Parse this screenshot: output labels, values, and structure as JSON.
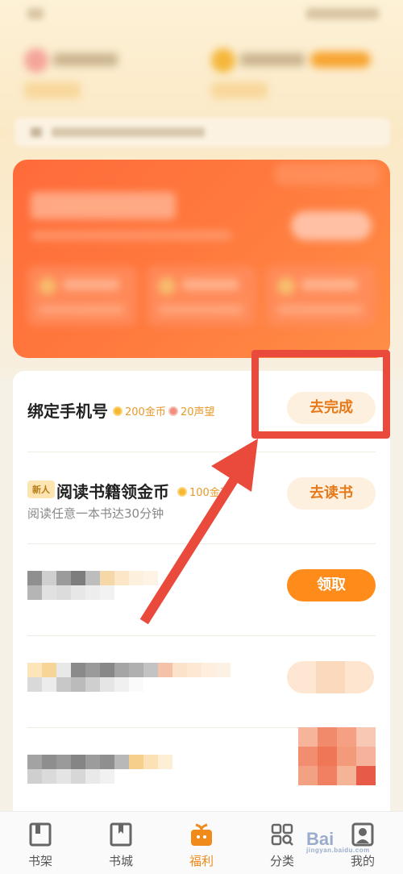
{
  "tasks": [
    {
      "title": "绑定手机号",
      "rewards": [
        {
          "type": "coin",
          "text": "200金币"
        },
        {
          "type": "reputation",
          "text": "20声望"
        }
      ],
      "button": "去完成",
      "button_style": "light"
    },
    {
      "badge": "新人",
      "title": "阅读书籍领金币",
      "rewards": [
        {
          "type": "coin",
          "text": "100金币"
        }
      ],
      "description": "阅读任意一本书达30分钟",
      "button": "去读书",
      "button_style": "light"
    },
    {
      "button": "领取",
      "button_style": "solid"
    }
  ],
  "bottom_nav": {
    "items": [
      {
        "label": "书架",
        "icon": "bookshelf-icon",
        "active": false
      },
      {
        "label": "书城",
        "icon": "bookstore-icon",
        "active": false
      },
      {
        "label": "福利",
        "icon": "gift-icon",
        "active": true
      },
      {
        "label": "分类",
        "icon": "category-icon",
        "active": false
      },
      {
        "label": "我的",
        "icon": "profile-icon",
        "active": false
      }
    ]
  },
  "watermark": {
    "brand": "Bai",
    "sub": "jingyan.baidu.com"
  },
  "colors": {
    "accent_orange": "#ff8c1a",
    "annotation_red": "#e94a3c",
    "promo_card": "#ff6b3a"
  }
}
